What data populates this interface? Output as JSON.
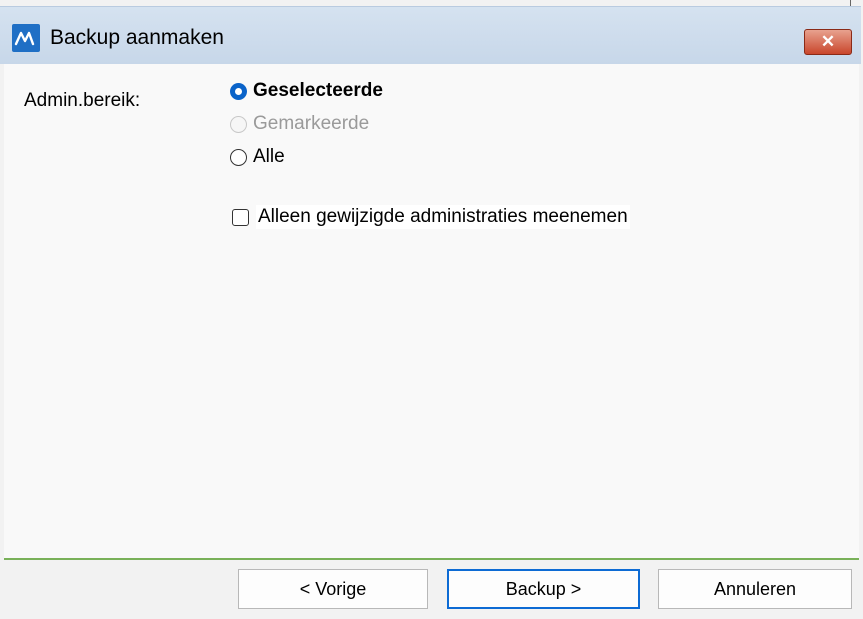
{
  "window": {
    "title": "Backup aanmaken",
    "close_glyph": "✕",
    "app_icon": "av-logo-icon"
  },
  "form": {
    "range_label": "Admin.bereik:",
    "options": [
      {
        "label": "Geselecteerde",
        "checked": true,
        "enabled": true
      },
      {
        "label": "Gemarkeerde",
        "checked": false,
        "enabled": false
      },
      {
        "label": "Alle",
        "checked": false,
        "enabled": true
      }
    ],
    "only_changed_label": "Alleen gewijzigde administraties meenemen",
    "only_changed_checked": false
  },
  "buttons": {
    "previous": "< Vorige",
    "backup": "Backup >",
    "cancel": "Annuleren"
  },
  "colors": {
    "accent": "#0a63c9",
    "separator": "#79b159",
    "close": "#c9462c"
  }
}
